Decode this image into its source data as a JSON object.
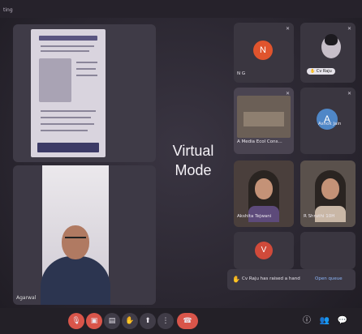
{
  "app": {
    "title": "ting"
  },
  "overlay_text": {
    "line1": "Virtual",
    "line2": "Mode"
  },
  "stage": {
    "speaker_name": "Agarwal"
  },
  "participants": [
    {
      "id": "ng",
      "name": "N G",
      "initial": "N",
      "avatar_color": "#e0542d"
    },
    {
      "id": "raju",
      "name": "Cv Raju"
    },
    {
      "id": "media",
      "name": "A Media Ecol Cons..."
    },
    {
      "id": "ashok",
      "name": "Ashok Jain",
      "initial": "A",
      "avatar_color": "#4f87c7"
    },
    {
      "id": "akshita",
      "name": "Akshita Tejwani"
    },
    {
      "id": "shruthi",
      "name": "R Shruthi 10H"
    },
    {
      "id": "v",
      "initial": "V",
      "avatar_color": "#d04a3a"
    }
  ],
  "notification": {
    "text": "Cv Raju has raised a hand",
    "link": "Open queue"
  },
  "controls": {
    "mic": "🎙",
    "camera": "▣",
    "captions": "▤",
    "raise_hand": "✋",
    "present": "⬆",
    "more": "⋮",
    "end_call": "☎",
    "info": "ⓘ",
    "people": "👥",
    "chat": "💬",
    "accent_red": "#d9554a"
  }
}
